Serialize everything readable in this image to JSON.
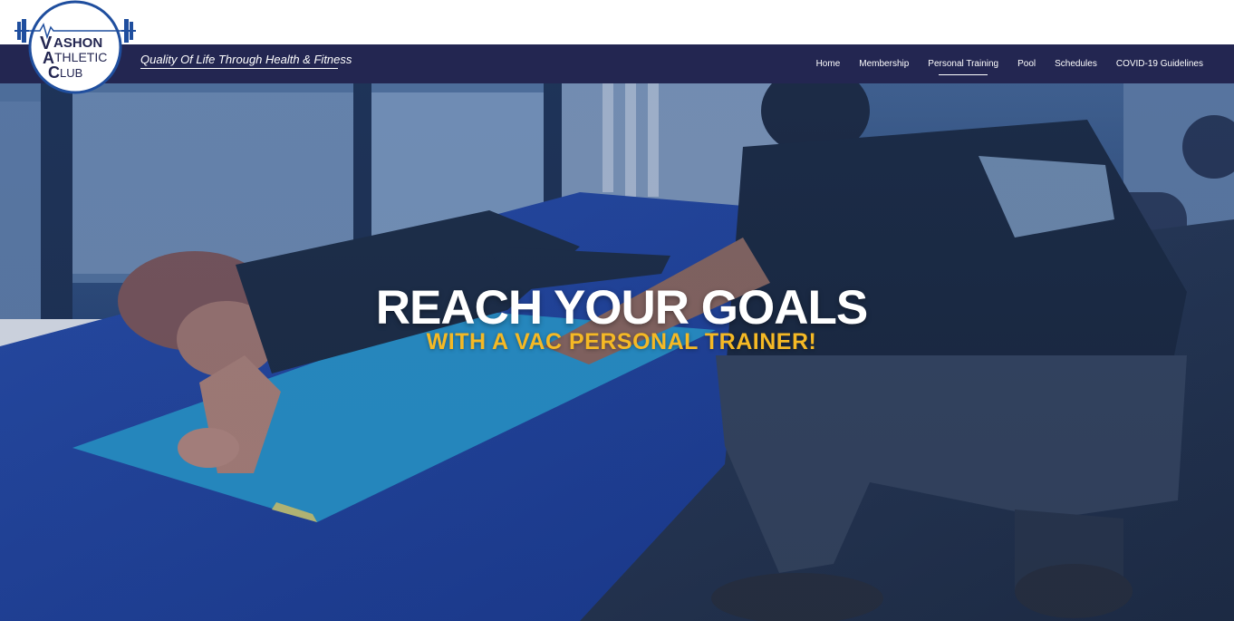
{
  "header": {
    "logo": {
      "line1": "ASHON",
      "line1_initial": "V",
      "line2": "THLETIC",
      "line2_initial": "A",
      "line3": "LUB",
      "line3_initial": "C"
    },
    "tagline": "Quality Of Life Through Health & Fitness"
  },
  "nav": {
    "items": [
      {
        "label": "Home"
      },
      {
        "label": "Membership"
      },
      {
        "label": "Personal Training",
        "active": true
      },
      {
        "label": "Pool"
      },
      {
        "label": "Schedules"
      },
      {
        "label": "COVID-19 Guidelines"
      }
    ]
  },
  "hero": {
    "headline": "REACH YOUR GOALS",
    "subheadline": "WITH A VAC PERSONAL TRAINER!"
  },
  "colors": {
    "nav_bg": "#232651",
    "accent_yellow": "#f5b925",
    "logo_blue": "#1f4e9e",
    "hero_overlay": "#1d3e78"
  }
}
